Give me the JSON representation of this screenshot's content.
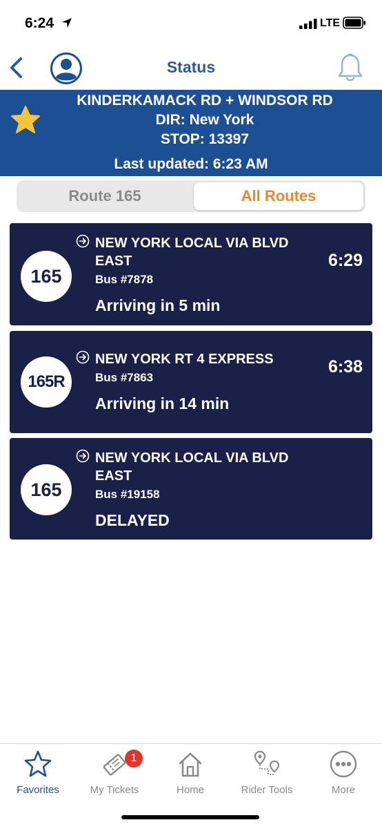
{
  "status_bar": {
    "time": "6:24",
    "network": "LTE"
  },
  "header": {
    "title": "Status"
  },
  "stop": {
    "name": "KINDERKAMACK RD + WINDSOR RD",
    "direction": "DIR: New York",
    "stop_id": "STOP: 13397",
    "last_updated": "Last updated: 6:23 AM"
  },
  "tabs": {
    "route": "Route 165",
    "all": "All Routes",
    "selected": "All Routes"
  },
  "arrivals": [
    {
      "route": "165",
      "destination": "NEW YORK LOCAL VIA BLVD EAST",
      "bus": "Bus #7878",
      "status": "Arriving in 5 min",
      "time": "6:29"
    },
    {
      "route": "165R",
      "destination": "NEW YORK  RT 4 EXPRESS",
      "bus": "Bus #7863",
      "status": "Arriving in 14 min",
      "time": "6:38"
    },
    {
      "route": "165",
      "destination": "NEW YORK LOCAL VIA BLVD EAST",
      "bus": "Bus #19158",
      "status": "DELAYED",
      "time": ""
    }
  ],
  "tabbar": {
    "items": [
      {
        "label": "Favorites",
        "icon": "star-icon",
        "active": true
      },
      {
        "label": "My Tickets",
        "icon": "ticket-icon",
        "badge": "1"
      },
      {
        "label": "Home",
        "icon": "home-icon"
      },
      {
        "label": "Rider Tools",
        "icon": "rider-tools-icon"
      },
      {
        "label": "More",
        "icon": "more-icon"
      }
    ]
  },
  "colors": {
    "brand_blue": "#1d4f94",
    "card_navy": "#1a2048",
    "accent_orange": "#e8892f",
    "star_yellow": "#f2c53d",
    "badge_red": "#e5322b"
  }
}
